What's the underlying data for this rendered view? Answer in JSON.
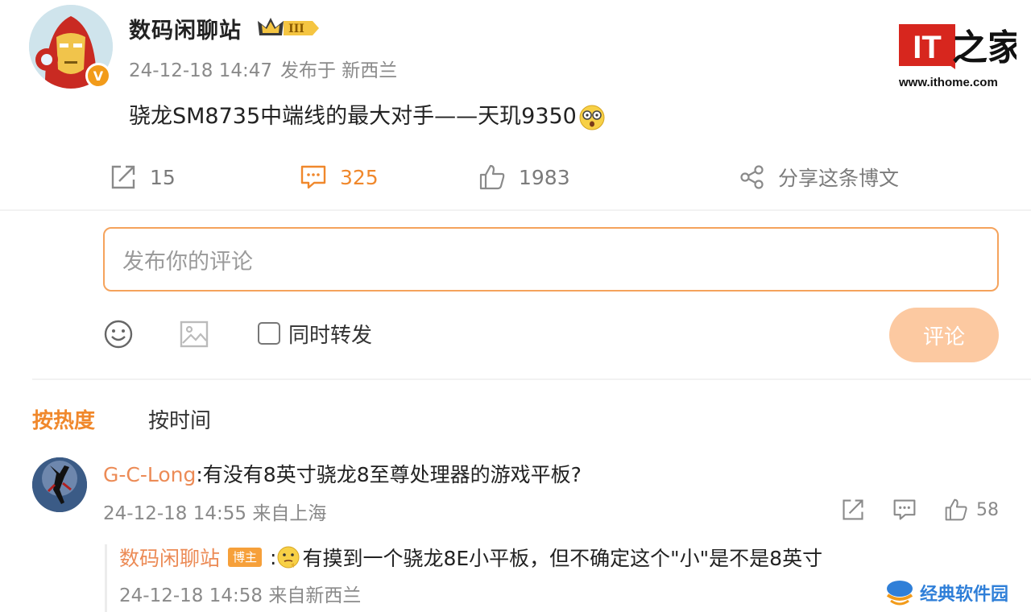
{
  "post": {
    "author": "数码闲聊站",
    "level_badge": "III",
    "verified_mark": "V",
    "timestamp": "24-12-18 14:47",
    "location": "发布于 新西兰",
    "text": "骁龙SM8735中端线的最大对手——天玑9350"
  },
  "watermark_logo": {
    "text": "IT之家",
    "url": "www.ithome.com"
  },
  "actions": {
    "share_count": "15",
    "comment_count": "325",
    "like_count": "1983",
    "forward_label": "分享这条博文"
  },
  "composer": {
    "placeholder": "发布你的评论",
    "repost_label": "同时转发",
    "submit_label": "评论"
  },
  "sort_tabs": {
    "hot": "按热度",
    "time": "按时间"
  },
  "comments": [
    {
      "user": "G-C-Long",
      "text": ":有没有8英寸骁龙8至尊处理器的游戏平板?",
      "timestamp": "24-12-18 14:55",
      "location": "来自上海",
      "like_count": "58",
      "replies": [
        {
          "user": "数码闲聊站",
          "badge": "博主",
          "text": "有摸到一个骁龙8E小平板，但不确定这个\"小\"是不是8英寸",
          "timestamp": "24-12-18 14:58",
          "location": "来自新西兰"
        }
      ]
    }
  ],
  "bottom_watermark": {
    "text": "经典软件园"
  },
  "colors": {
    "accent": "#f0882c",
    "username": "#ec8b56",
    "muted": "#8a8a8a",
    "submit_bg": "#fcc9a1"
  }
}
